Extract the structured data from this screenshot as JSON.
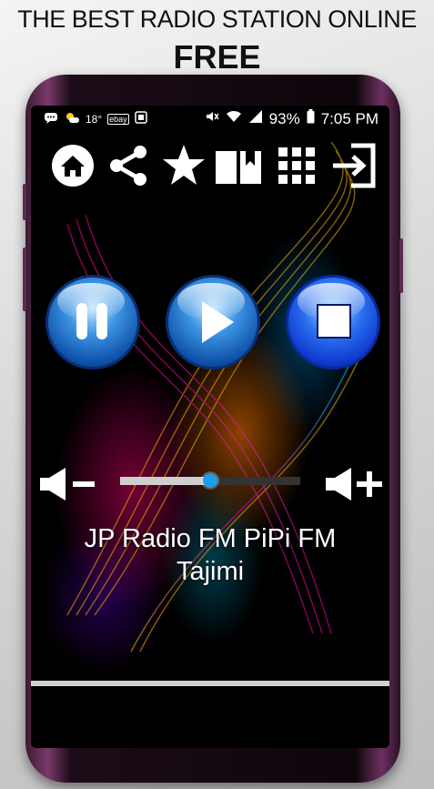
{
  "promo": {
    "line1": "THE BEST RADIO STATION ONLINE",
    "line2": "FREE"
  },
  "statusbar": {
    "temperature": "18°",
    "battery": "93%",
    "time": "7:05 PM",
    "left_icons": [
      "chat-icon",
      "weather-icon",
      "ebay-icon",
      "screenshot-icon"
    ],
    "right_icons": [
      "mute-icon",
      "wifi-icon",
      "signal-icon"
    ]
  },
  "toolbar": {
    "items": [
      "home-icon",
      "share-icon",
      "star-icon",
      "book-icon",
      "grid-icon",
      "exit-icon"
    ]
  },
  "controls": {
    "pause": "pause-icon",
    "play": "play-icon",
    "stop": "stop-icon"
  },
  "volume": {
    "level": 0.5
  },
  "station": {
    "line1": "JP Radio FM PiPi FM",
    "line2": "Tajimi"
  },
  "colors": {
    "accent": "#1aa0e8",
    "button_blue": "#0d4fa6",
    "stop_blue": "#0b2fc7",
    "phone_frame": "#7a3a6a"
  }
}
